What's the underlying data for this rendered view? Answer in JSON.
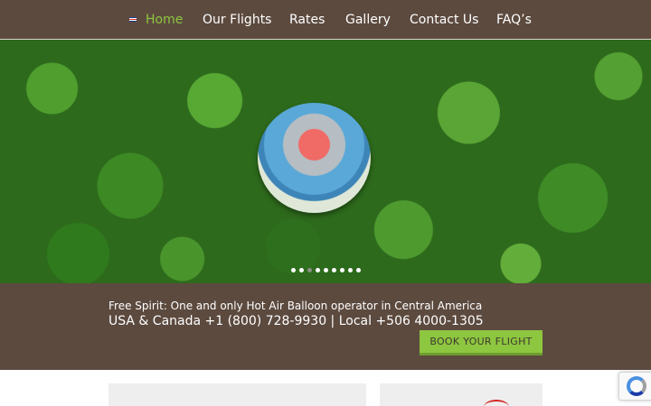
{
  "nav": {
    "items": [
      {
        "label": "Home",
        "active": true
      },
      {
        "label": "Our Flights"
      },
      {
        "label": "Rates"
      },
      {
        "label": "Gallery"
      },
      {
        "label": "Contact Us"
      },
      {
        "label": "FAQ’s"
      }
    ],
    "active_color": "#8dc63f",
    "background": "#5c4a3f"
  },
  "hero": {
    "image": "hot-air-balloon-over-forest-photo",
    "slider_dots": 9,
    "active_dot": 2
  },
  "info": {
    "tagline": "Free Spirit: One and only Hot Air Balloon operator in Central America",
    "phones": "USA & Canada +1 (800) 728-9930 | Local +506 4000-1305",
    "book_button": "BOOK YOUR FLIGHT",
    "button_color": "#8dc63f"
  },
  "icons": {
    "language_flag": "costa-rica-flag-icon",
    "captcha": "recaptcha-icon"
  }
}
